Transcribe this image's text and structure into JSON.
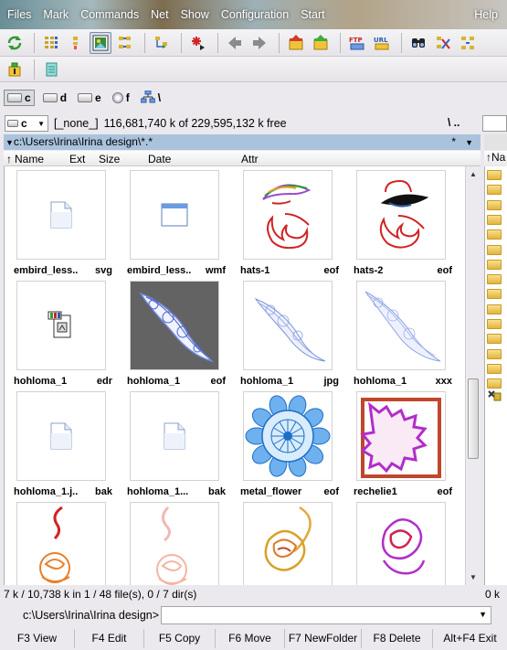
{
  "menu": {
    "items": [
      "Files",
      "Mark",
      "Commands",
      "Net",
      "Show",
      "Configuration",
      "Start"
    ],
    "help": "Help"
  },
  "toolbar1": {
    "buttons": [
      "refresh-icon",
      "brief-view-icon",
      "details-view-icon",
      "thumbnails-view-icon",
      "tree-view-icon",
      "filter-icon",
      "invert-selection-icon",
      "back-icon",
      "forward-icon",
      "pack-icon",
      "unpack-icon",
      "ftp-icon",
      "url-icon",
      "find-icon",
      "rename-icon",
      "sync-icon"
    ],
    "ftp_label": "FTP",
    "url_label": "URL"
  },
  "toolbar2": {
    "buttons": [
      "archive-icon",
      "notepad-icon"
    ]
  },
  "drives": [
    {
      "letter": "c",
      "selected": true
    },
    {
      "letter": "d",
      "selected": false
    },
    {
      "letter": "e",
      "selected": false
    },
    {
      "letter": "f",
      "selected": false
    },
    {
      "letter": "\\",
      "selected": false
    }
  ],
  "left_panel": {
    "drive": "c",
    "volume_label": "[_none_]",
    "free_space": "116,681,740 k of 229,595,132 k free",
    "path": "c:\\Users\\Irina\\Irina design\\*.*",
    "path_star": "*",
    "columns": [
      "Name",
      "Ext",
      "Size",
      "Date",
      "Attr"
    ],
    "files": [
      {
        "name": "embird_less..",
        "ext": "svg",
        "thumb": "doc"
      },
      {
        "name": "embird_less..",
        "ext": "wmf",
        "thumb": "window"
      },
      {
        "name": "hats-1",
        "ext": "eof",
        "thumb": "hats1"
      },
      {
        "name": "hats-2",
        "ext": "eof",
        "thumb": "hats2"
      },
      {
        "name": "hohloma_1",
        "ext": "edr",
        "thumb": "edr"
      },
      {
        "name": "hohloma_1",
        "ext": "eof",
        "thumb": "dark"
      },
      {
        "name": "hohloma_1",
        "ext": "jpg",
        "thumb": "lightblue"
      },
      {
        "name": "hohloma_1",
        "ext": "xxx",
        "thumb": "lightblue2"
      },
      {
        "name": "hohloma_1.j..",
        "ext": "bak",
        "thumb": "doc"
      },
      {
        "name": "hohloma_1...",
        "ext": "bak",
        "thumb": "doc"
      },
      {
        "name": "metal_flower",
        "ext": "eof",
        "thumb": "flower"
      },
      {
        "name": "rechelie1",
        "ext": "eof",
        "thumb": "rechelie"
      },
      {
        "name": "",
        "ext": "",
        "thumb": "rose_orange"
      },
      {
        "name": "",
        "ext": "",
        "thumb": "rose_pink"
      },
      {
        "name": "",
        "ext": "",
        "thumb": "rose_gold"
      },
      {
        "name": "",
        "ext": "",
        "thumb": "rose_purple"
      }
    ]
  },
  "right_panel": {
    "bits": "\\   ..",
    "column": "Na",
    "status": "0 k"
  },
  "status": "7 k / 10,738 k in 1 / 48 file(s), 0 / 7 dir(s)",
  "command": {
    "label": "c:\\Users\\Irina\\Irina design>",
    "value": ""
  },
  "fkeys": [
    "F3 View",
    "F4 Edit",
    "F5 Copy",
    "F6 Move",
    "F7 NewFolder",
    "F8 Delete",
    "Alt+F4 Exit"
  ]
}
